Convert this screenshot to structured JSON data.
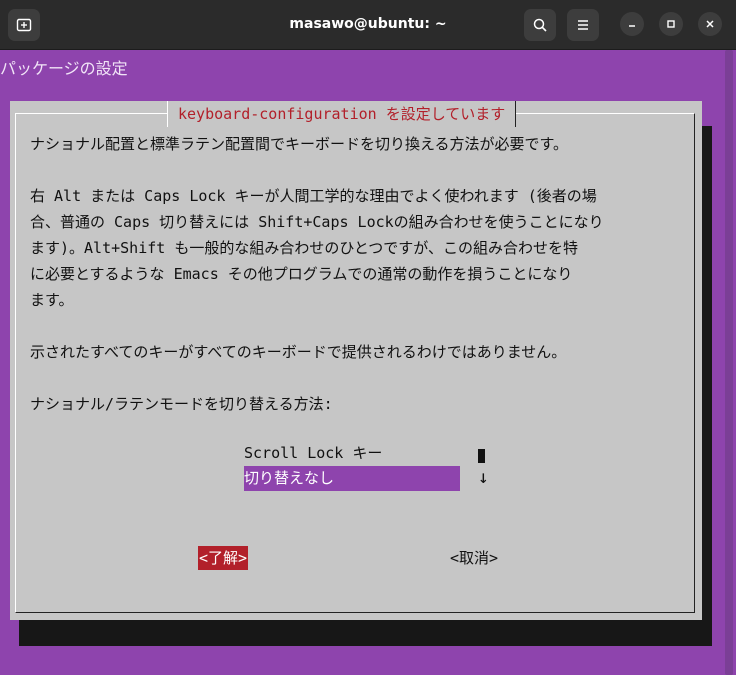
{
  "window": {
    "title": "masawo@ubuntu: ~"
  },
  "terminal": {
    "header": "パッケージの設定"
  },
  "dialog": {
    "title": "keyboard-configuration を設定しています",
    "paragraphs": [
      "ナショナル配置と標準ラテン配置間でキーボードを切り換える方法が必要です。",
      "",
      "右 Alt または Caps Lock キーが人間工学的な理由でよく使われます (後者の場",
      "合、普通の Caps 切り替えには Shift+Caps Lockの組み合わせを使うことになり",
      "ます)。Alt+Shift も一般的な組み合わせのひとつですが、この組み合わせを特",
      "に必要とするような Emacs その他プログラムでの通常の動作を損うことになり",
      "ます。",
      "",
      "示されたすべてのキーがすべてのキーボードで提供されるわけではありません。",
      "",
      "ナショナル/ラテンモードを切り替える方法:"
    ],
    "options": [
      {
        "label": "Scroll Lock キー",
        "selected": false
      },
      {
        "label": "切り替えなし",
        "selected": true
      }
    ],
    "ok_label": "<了解>",
    "cancel_label": "<取消>"
  },
  "colors": {
    "terminal_bg": "#8e44ad",
    "dialog_bg": "#c6c6c6",
    "accent": "#b2202a",
    "selection": "#8e44ad"
  },
  "icons": [
    "new-tab-icon",
    "search-icon",
    "menu-icon",
    "minimize-icon",
    "maximize-icon",
    "close-icon"
  ]
}
